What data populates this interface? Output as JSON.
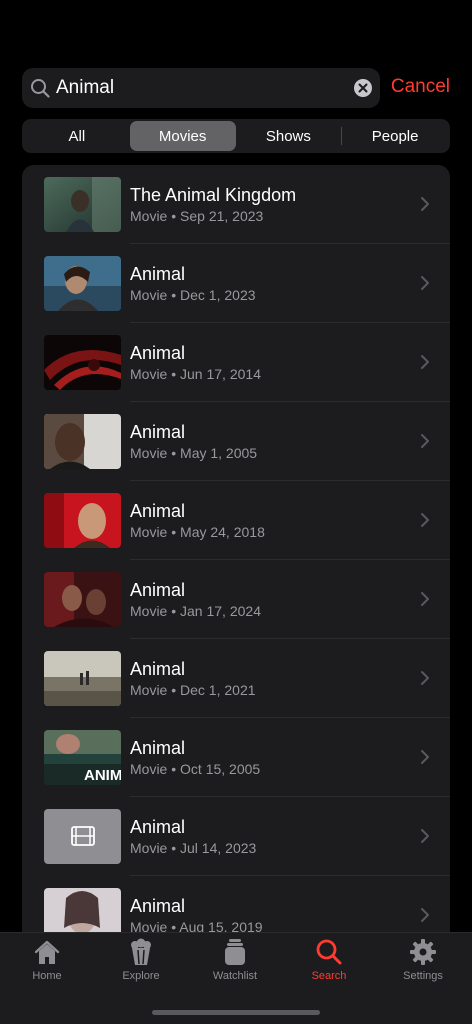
{
  "search": {
    "query": "Animal",
    "cancel_label": "Cancel"
  },
  "segments": [
    {
      "label": "All",
      "active": false
    },
    {
      "label": "Movies",
      "active": true
    },
    {
      "label": "Shows",
      "active": false
    },
    {
      "label": "People",
      "active": false
    }
  ],
  "results": [
    {
      "title": "The Animal Kingdom",
      "subtitle": "Movie • Sep 21, 2023"
    },
    {
      "title": "Animal",
      "subtitle": "Movie • Dec 1, 2023"
    },
    {
      "title": "Animal",
      "subtitle": "Movie • Jun 17, 2014"
    },
    {
      "title": "Animal",
      "subtitle": "Movie • May 1, 2005"
    },
    {
      "title": "Animal",
      "subtitle": "Movie • May 24, 2018"
    },
    {
      "title": "Animal",
      "subtitle": "Movie • Jan 17, 2024"
    },
    {
      "title": "Animal",
      "subtitle": "Movie • Dec 1, 2021"
    },
    {
      "title": "Animal",
      "subtitle": "Movie • Oct 15, 2005"
    },
    {
      "title": "Animal",
      "subtitle": "Movie • Jul 14, 2023"
    },
    {
      "title": "Animal",
      "subtitle": "Movie • Aug 15, 2019"
    }
  ],
  "tabs": [
    {
      "label": "Home",
      "icon": "house-icon",
      "active": false
    },
    {
      "label": "Explore",
      "icon": "popcorn-icon",
      "active": false
    },
    {
      "label": "Watchlist",
      "icon": "stack-icon",
      "active": false
    },
    {
      "label": "Search",
      "icon": "search-icon",
      "active": true
    },
    {
      "label": "Settings",
      "icon": "gear-icon",
      "active": false
    }
  ],
  "colors": {
    "accent": "#ff3b30",
    "background": "#000000",
    "surface": "#1c1c1e",
    "secondary_text": "#98989d"
  }
}
